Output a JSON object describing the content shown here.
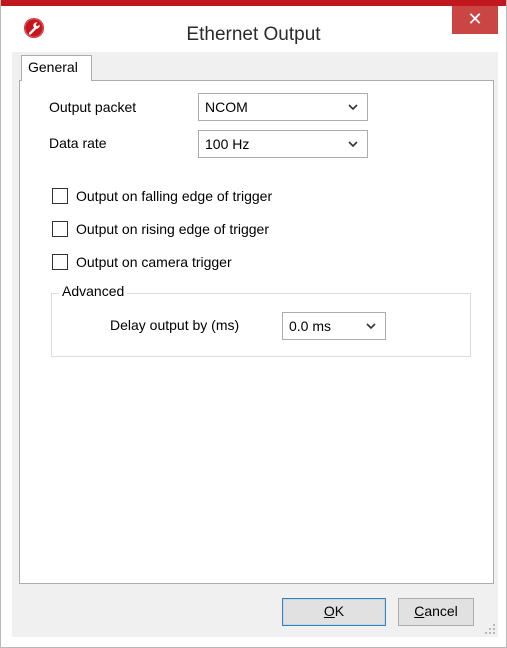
{
  "window": {
    "title": "Ethernet Output",
    "close_glyph": "✕",
    "app_icon": "wrench-icon",
    "accent": "#c1171e"
  },
  "tabs": [
    {
      "label": "General",
      "selected": true
    }
  ],
  "general": {
    "output_packet": {
      "label": "Output packet",
      "value": "NCOM"
    },
    "data_rate": {
      "label": "Data rate",
      "value": "100 Hz"
    },
    "checkboxes": [
      {
        "label": "Output on falling edge of trigger",
        "checked": false
      },
      {
        "label": "Output on rising edge of trigger",
        "checked": false
      },
      {
        "label": "Output on camera trigger",
        "checked": false
      }
    ],
    "advanced": {
      "title": "Advanced",
      "delay_label": "Delay output by (ms)",
      "delay_value": "0.0 ms"
    }
  },
  "buttons": {
    "ok": {
      "mnemonic": "O",
      "rest": "K"
    },
    "cancel": {
      "mnemonic": "C",
      "rest": "ancel"
    }
  }
}
